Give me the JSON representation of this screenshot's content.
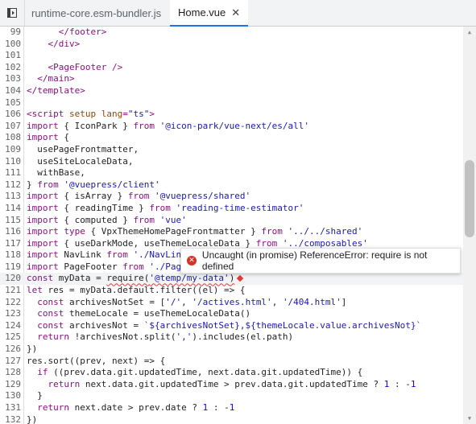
{
  "tabs": [
    {
      "label": "runtime-core.esm-bundler.js",
      "active": false
    },
    {
      "label": "Home.vue",
      "active": true,
      "close": "✕"
    }
  ],
  "editor": {
    "current_line": 120,
    "lines": [
      {
        "n": "99",
        "tokens": [
          [
            "      ",
            ""
          ],
          [
            "</footer>",
            "tag"
          ]
        ]
      },
      {
        "n": "100",
        "tokens": [
          [
            "    ",
            ""
          ],
          [
            "</div>",
            "tag"
          ]
        ]
      },
      {
        "n": "101",
        "tokens": [
          [
            "",
            ""
          ]
        ]
      },
      {
        "n": "102",
        "tokens": [
          [
            "    ",
            ""
          ],
          [
            "<PageFooter />",
            "tag"
          ]
        ]
      },
      {
        "n": "103",
        "tokens": [
          [
            "  ",
            ""
          ],
          [
            "</main>",
            "tag"
          ]
        ]
      },
      {
        "n": "104",
        "tokens": [
          [
            "</template>",
            "tag"
          ]
        ]
      },
      {
        "n": "105",
        "tokens": [
          [
            "",
            ""
          ]
        ]
      },
      {
        "n": "106",
        "tokens": [
          [
            "<script ",
            "tag"
          ],
          [
            "setup ",
            "attr"
          ],
          [
            "lang",
            "attr"
          ],
          [
            "=",
            "tag"
          ],
          [
            "\"ts\"",
            "str"
          ],
          [
            ">",
            "tag"
          ]
        ]
      },
      {
        "n": "107",
        "tokens": [
          [
            "import",
            "kw"
          ],
          [
            " { IconPark } ",
            ""
          ],
          [
            "from",
            "kw"
          ],
          [
            " ",
            ""
          ],
          [
            "'@icon-park/vue-next/es/all'",
            "str"
          ]
        ]
      },
      {
        "n": "108",
        "tokens": [
          [
            "import",
            "kw"
          ],
          [
            " {",
            ""
          ]
        ]
      },
      {
        "n": "109",
        "tokens": [
          [
            "  usePageFrontmatter,",
            ""
          ]
        ]
      },
      {
        "n": "110",
        "tokens": [
          [
            "  useSiteLocaleData,",
            ""
          ]
        ]
      },
      {
        "n": "111",
        "tokens": [
          [
            "  withBase,",
            ""
          ]
        ]
      },
      {
        "n": "112",
        "tokens": [
          [
            "} ",
            ""
          ],
          [
            "from",
            "kw"
          ],
          [
            " ",
            ""
          ],
          [
            "'@vuepress/client'",
            "str"
          ]
        ]
      },
      {
        "n": "113",
        "tokens": [
          [
            "import",
            "kw"
          ],
          [
            " { isArray } ",
            ""
          ],
          [
            "from",
            "kw"
          ],
          [
            " ",
            ""
          ],
          [
            "'@vuepress/shared'",
            "str"
          ]
        ]
      },
      {
        "n": "114",
        "tokens": [
          [
            "import",
            "kw"
          ],
          [
            " { readingTime } ",
            ""
          ],
          [
            "from",
            "kw"
          ],
          [
            " ",
            ""
          ],
          [
            "'reading-time-estimator'",
            "str"
          ]
        ]
      },
      {
        "n": "115",
        "tokens": [
          [
            "import",
            "kw"
          ],
          [
            " { computed } ",
            ""
          ],
          [
            "from",
            "kw"
          ],
          [
            " ",
            ""
          ],
          [
            "'vue'",
            "str"
          ]
        ]
      },
      {
        "n": "116",
        "tokens": [
          [
            "import",
            "kw"
          ],
          [
            " ",
            ""
          ],
          [
            "type",
            "kw"
          ],
          [
            " { VpxThemeHomePageFrontmatter } ",
            ""
          ],
          [
            "from",
            "kw"
          ],
          [
            " ",
            ""
          ],
          [
            "'../../shared'",
            "str"
          ]
        ]
      },
      {
        "n": "117",
        "tokens": [
          [
            "import",
            "kw"
          ],
          [
            " { useDarkMode, useThemeLocaleData } ",
            ""
          ],
          [
            "from",
            "kw"
          ],
          [
            " ",
            ""
          ],
          [
            "'../composables'",
            "str"
          ]
        ]
      },
      {
        "n": "118",
        "tokens": [
          [
            "import",
            "kw"
          ],
          [
            " NavLink ",
            ""
          ],
          [
            "from",
            "kw"
          ],
          [
            " ",
            ""
          ],
          [
            "'./NavLin",
            "str"
          ]
        ]
      },
      {
        "n": "119",
        "tokens": [
          [
            "import",
            "kw"
          ],
          [
            " PageFooter ",
            ""
          ],
          [
            "from",
            "kw"
          ],
          [
            " ",
            ""
          ],
          [
            "'./Pag",
            "str"
          ]
        ]
      },
      {
        "n": "120",
        "tokens": [
          [
            "const",
            "kw"
          ],
          [
            " myData = ",
            ""
          ],
          [
            "require(",
            "squig"
          ],
          [
            "'@temp/my-data'",
            "squigstr"
          ],
          [
            ")",
            "squig"
          ]
        ],
        "error": true
      },
      {
        "n": "121",
        "tokens": [
          [
            "let",
            "kw"
          ],
          [
            " res = myData.default.filter((el) => {",
            ""
          ]
        ]
      },
      {
        "n": "122",
        "tokens": [
          [
            "  ",
            ""
          ],
          [
            "const",
            "kw"
          ],
          [
            " archivesNotSet = [",
            ""
          ],
          [
            "'/'",
            "str"
          ],
          [
            ", ",
            ""
          ],
          [
            "'/actives.html'",
            "str"
          ],
          [
            ", ",
            ""
          ],
          [
            "'/404.html'",
            "str"
          ],
          [
            "]",
            ""
          ]
        ]
      },
      {
        "n": "123",
        "tokens": [
          [
            "  ",
            ""
          ],
          [
            "const",
            "kw"
          ],
          [
            " themeLocale = useThemeLocaleData()",
            ""
          ]
        ]
      },
      {
        "n": "124",
        "tokens": [
          [
            "  ",
            ""
          ],
          [
            "const",
            "kw"
          ],
          [
            " archivesNot = ",
            ""
          ],
          [
            "`${archivesNotSet},${themeLocale.value.archivesNot}`",
            "str"
          ]
        ]
      },
      {
        "n": "125",
        "tokens": [
          [
            "  ",
            ""
          ],
          [
            "return",
            "kw"
          ],
          [
            " !archivesNot.split(",
            ""
          ],
          [
            "','",
            "str"
          ],
          [
            ").includes(el.path)",
            ""
          ]
        ]
      },
      {
        "n": "126",
        "tokens": [
          [
            "})",
            ""
          ]
        ]
      },
      {
        "n": "127",
        "tokens": [
          [
            "res.sort((prev, next) => {",
            ""
          ]
        ]
      },
      {
        "n": "128",
        "tokens": [
          [
            "  ",
            ""
          ],
          [
            "if",
            "kw"
          ],
          [
            " ((prev.data.git.updatedTime, next.data.git.updatedTime)) {",
            ""
          ]
        ]
      },
      {
        "n": "129",
        "tokens": [
          [
            "    ",
            ""
          ],
          [
            "return",
            "kw"
          ],
          [
            " next.data.git.updatedTime > prev.data.git.updatedTime ? ",
            ""
          ],
          [
            "1",
            "num"
          ],
          [
            " : -",
            ""
          ],
          [
            "1",
            "num"
          ]
        ]
      },
      {
        "n": "130",
        "tokens": [
          [
            "  }",
            ""
          ]
        ]
      },
      {
        "n": "131",
        "tokens": [
          [
            "  ",
            ""
          ],
          [
            "return",
            "kw"
          ],
          [
            " next.date > prev.date ? ",
            ""
          ],
          [
            "1",
            "num"
          ],
          [
            " : -",
            ""
          ],
          [
            "1",
            "num"
          ]
        ]
      },
      {
        "n": "132",
        "tokens": [
          [
            "})",
            ""
          ]
        ]
      }
    ]
  },
  "tooltip": {
    "icon": "error-icon",
    "message": "Uncaught (in promise) ReferenceError: require is not defined"
  }
}
